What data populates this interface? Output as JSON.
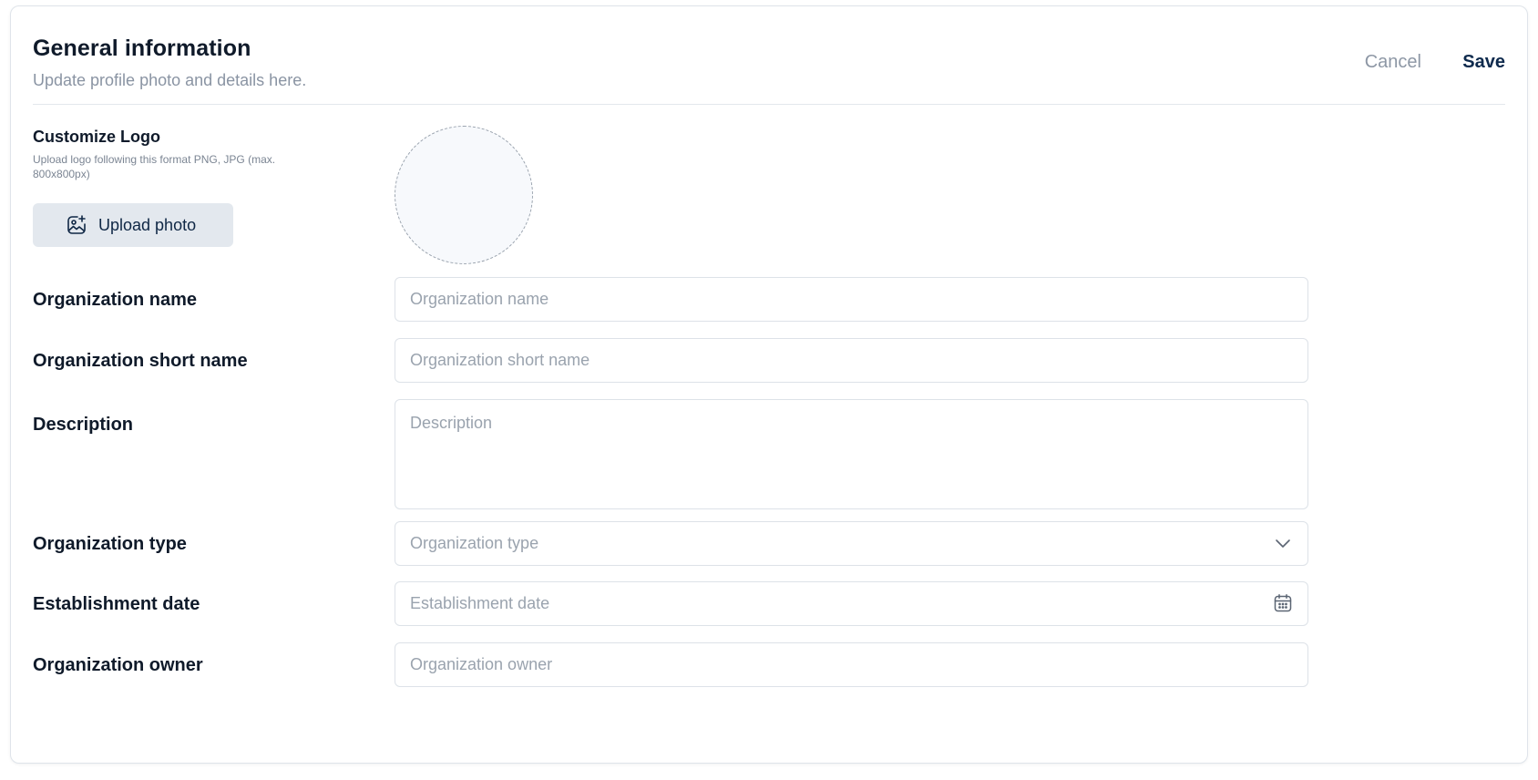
{
  "header": {
    "title": "General information",
    "subtitle": "Update profile photo and details here.",
    "cancel_label": "Cancel",
    "save_label": "Save"
  },
  "logo": {
    "label": "Customize Logo",
    "hint": "Upload logo following this format PNG, JPG (max. 800x800px)",
    "upload_label": "Upload photo",
    "upload_icon": "image-plus-icon"
  },
  "form": {
    "org_name": {
      "label": "Organization name",
      "placeholder": "Organization name",
      "value": ""
    },
    "org_short_name": {
      "label": "Organization short name",
      "placeholder": "Organization short name",
      "value": ""
    },
    "description": {
      "label": "Description",
      "placeholder": "Description",
      "value": ""
    },
    "org_type": {
      "label": "Organization type",
      "placeholder": "Organization type",
      "value": "",
      "icon": "chevron-down-icon"
    },
    "establishment_date": {
      "label": "Establishment date",
      "placeholder": "Establishment date",
      "value": "",
      "icon": "calendar-icon"
    },
    "org_owner": {
      "label": "Organization owner",
      "placeholder": "Organization owner",
      "value": ""
    }
  },
  "colors": {
    "primary_text": "#0f1a2a",
    "muted_text": "#8a94a3",
    "save_accent": "#0e2a4d",
    "upload_bg": "#e3e8ee",
    "border": "#dde2e8"
  }
}
